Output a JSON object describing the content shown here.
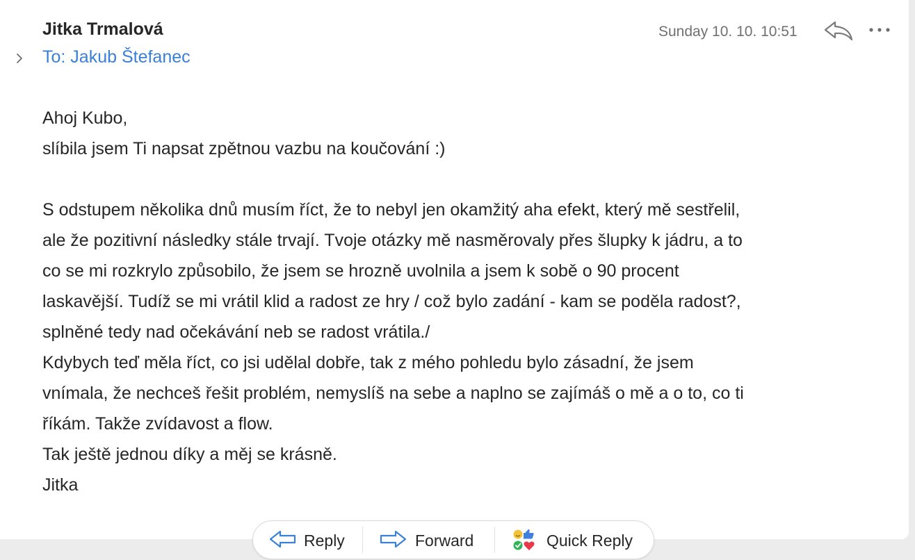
{
  "header": {
    "sender_name": "Jitka Trmalová",
    "recipient_line": "To: Jakub Štefanec",
    "date": "Sunday 10. 10. 10:51"
  },
  "icons": {
    "expand": "chevron-right-icon",
    "reply": "reply-arrow-icon",
    "more": "ellipsis-icon",
    "forward": "forward-arrow-icon",
    "quick_reply": "emoji-reactions-icon"
  },
  "colors": {
    "accent": "#3a80d6",
    "text": "#262626",
    "muted": "#707070"
  },
  "body": {
    "greeting": "Ahoj Kubo,",
    "intro": "slíbila jsem Ti napsat zpětnou vazbu na koučování :)",
    "paragraph_lines": [
      "S odstupem několika dnů musím říct, že to nebyl jen okamžitý aha efekt, který mě sestřelil,",
      "ale že pozitivní následky stále trvají. Tvoje otázky  mě nasměrovaly přes šlupky k jádru, a to",
      "co se mi rozkrylo způsobilo, že jsem se hrozně uvolnila a jsem k sobě o 90 procent",
      "laskavější. Tudíž se mi vrátil klid a radost ze hry / což bylo zadání - kam se poděla radost?,",
      "splněné tedy nad očekávání neb se radost vrátila./",
      "Kdybych teď měla říct, co jsi udělal dobře, tak z mého pohledu bylo zásadní, že jsem",
      "vnímala, že nechceš řešit problém, nemyslíš na sebe a naplno se zajímáš o mě a o to, co ti",
      "říkám. Takže zvídavost a flow.",
      "Tak ještě jednou díky a měj se krásně.",
      "Jitka"
    ]
  },
  "actions": {
    "reply_label": "Reply",
    "forward_label": "Forward",
    "quick_reply_label": "Quick Reply"
  }
}
